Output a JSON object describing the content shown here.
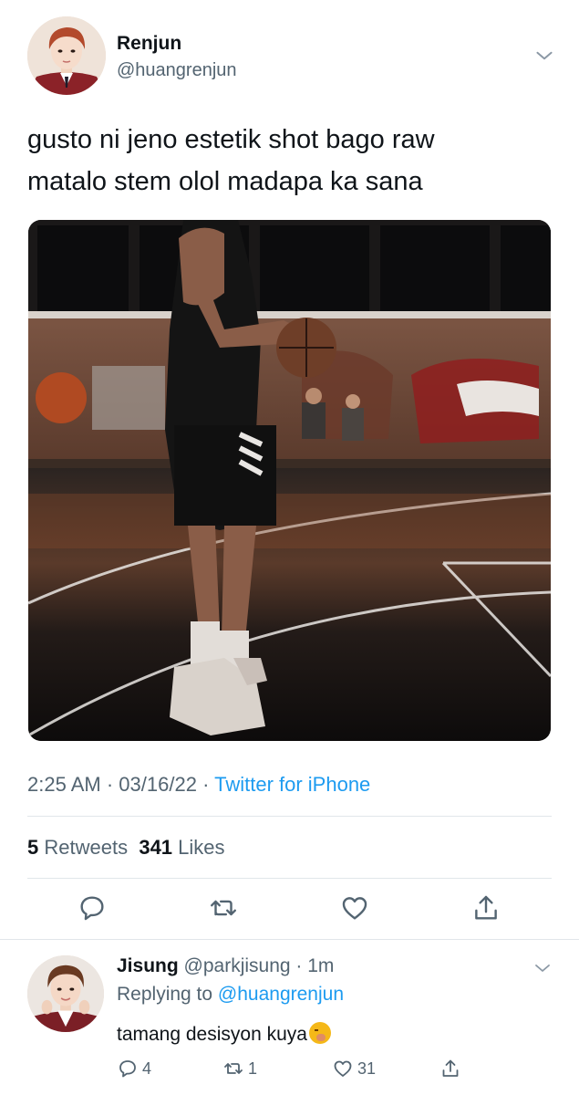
{
  "tweet": {
    "author_name": "Renjun",
    "author_handle": "@huangrenjun",
    "text_line1": "gusto ni jeno estetik shot bago raw",
    "text_line2": "matalo stem olol madapa ka sana",
    "time": "2:25 AM",
    "date": "03/16/22",
    "source": "Twitter for iPhone",
    "retweet_count": "5",
    "retweet_label": "Retweets",
    "like_count": "341",
    "like_label": "Likes"
  },
  "icons": {
    "more": "chevron-down-icon",
    "reply": "comment-icon",
    "retweet": "retweet-icon",
    "like": "heart-icon",
    "share": "share-icon"
  },
  "reply": {
    "author_name": "Jisung",
    "author_handle": "@parkjisung",
    "time": "1m",
    "replying_prefix": "Replying to",
    "replying_handle": "@huangrenjun",
    "text": "tamang desisyon kuya",
    "reply_count": "4",
    "retweet_count": "1",
    "like_count": "31"
  },
  "colors": {
    "accent": "#1d9bf0",
    "secondary_text": "#536471",
    "primary_text": "#0f1419"
  }
}
